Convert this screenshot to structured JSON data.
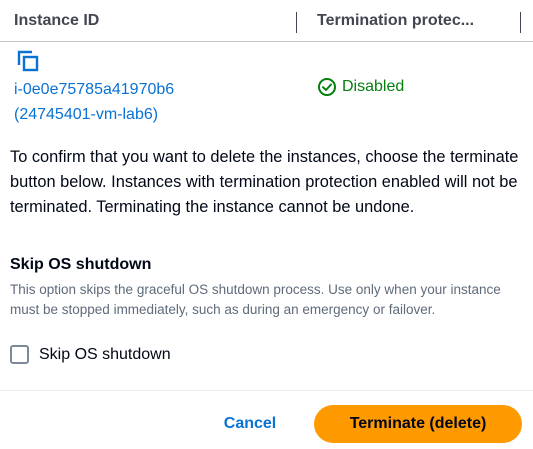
{
  "table": {
    "columns": [
      "Instance ID",
      "Termination protec..."
    ],
    "rows": [
      {
        "instance_id_line1": "i-0e0e75785a41970b6",
        "instance_id_line2": "(24745401-vm-lab6)",
        "termination_protection": "Disabled",
        "status_icon": "check-circle-icon",
        "action_icon": "copy-icon"
      }
    ]
  },
  "confirm_message": "To confirm that you want to delete the instances, choose the terminate button below. Instances with termination protection enabled will not be terminated. Terminating the instance cannot be undone.",
  "skip_os": {
    "title": "Skip OS shutdown",
    "description": "This option skips the graceful OS shutdown process. Use only when your instance must be stopped immediately, such as during an emergency or failover.",
    "checkbox_label": "Skip OS shutdown",
    "checked": false
  },
  "footer": {
    "cancel_label": "Cancel",
    "terminate_label": "Terminate (delete)"
  },
  "colors": {
    "link": "#0972d3",
    "success": "#037f0c",
    "primary_button": "#ff9900",
    "text": "#000716",
    "muted_text": "#5f6b7a"
  }
}
